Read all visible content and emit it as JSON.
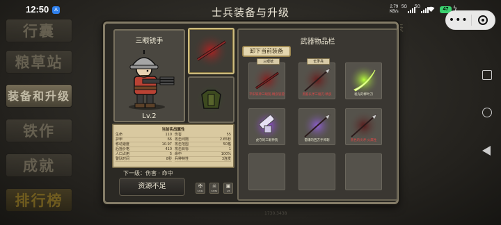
{
  "status_bar": {
    "time": "12:50",
    "notification_badge": "A",
    "net_speed_value": "2.79",
    "net_speed_unit": "KB/s",
    "signal_1": "5G",
    "signal_2": "5G",
    "battery": "47"
  },
  "title": "士兵装备与升级",
  "side_menu": [
    "行囊",
    "粮草站",
    "装备和升级",
    "铁作",
    "成就",
    "排行榜"
  ],
  "bg_edge_text": "表",
  "bg_bottom_text": "1730.3438",
  "character": {
    "name": "三眼铳手",
    "level": "Lv.2"
  },
  "stats": {
    "title": "当前实战属性",
    "rows": [
      {
        "label": "生命",
        "value": "110"
      },
      {
        "label": "伤害",
        "value": "55"
      },
      {
        "label": "护甲",
        "value": "66"
      },
      {
        "label": "攻击间隔",
        "value": "2.65秒"
      },
      {
        "label": "移动速度",
        "value": "10.97"
      },
      {
        "label": "攻击范围",
        "value": "50格"
      },
      {
        "label": "后摇价格",
        "value": "410"
      },
      {
        "label": "攻击目标",
        "value": "1"
      },
      {
        "label": "人口占用",
        "value": "5"
      },
      {
        "label": "命中",
        "value": "100%"
      },
      {
        "label": "警队时间",
        "value": "8秒"
      },
      {
        "label": "兵种特性",
        "value": "3连发"
      }
    ]
  },
  "next_level": "下一级：伤害 · 命中",
  "insufficient_button": "资源不足",
  "resources": [
    {
      "icon": "gun-icon",
      "symbol": "✠",
      "label": "63/41"
    },
    {
      "icon": "skull-icon",
      "symbol": "☠",
      "label": "65/89"
    },
    {
      "icon": "helmet-icon",
      "symbol": "▣",
      "label": "1/8"
    }
  ],
  "inventory": {
    "title": "武器物品栏",
    "unequip_button": "卸下当前装备",
    "items": [
      {
        "name": "平阳铁神三眼铳·精良铳管",
        "tag": "三眼铳",
        "color": "#e04848",
        "glow": "#8a1d1d",
        "kind": "gun"
      },
      {
        "name": "黑筋长矛三棱刃·精良",
        "tag": "长矛兵",
        "color": "#e04848",
        "glow": "#6b1c1c",
        "kind": "spear"
      },
      {
        "name": "发光的柳叶刀",
        "tag": "",
        "color": "#e8e8d0",
        "glow": "#b8ff3a",
        "kind": "saber"
      },
      {
        "name": "虎守的三眼神铳",
        "tag": "",
        "color": "#e8e8d0",
        "glow": "#a048ff",
        "kind": "cannon"
      },
      {
        "name": "雷爆的西方手斧刺",
        "tag": "",
        "color": "#e8e8d0",
        "glow": "#8f5ed8",
        "kind": "spear"
      },
      {
        "name": "黑色的尖矛·火属性",
        "tag": "",
        "color": "#e04848",
        "glow": "#5a1c1c",
        "kind": "spear"
      },
      {
        "name": "",
        "tag": "",
        "color": "",
        "glow": "",
        "kind": "empty"
      },
      {
        "name": "",
        "tag": "",
        "color": "",
        "glow": "",
        "kind": "empty"
      },
      {
        "name": "",
        "tag": "",
        "color": "",
        "glow": "",
        "kind": "empty"
      }
    ]
  }
}
